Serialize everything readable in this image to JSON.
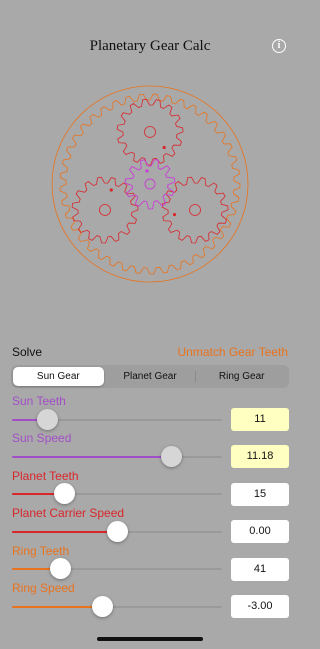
{
  "header": {
    "title": "Planetary Gear Calc",
    "info_icon": "info-icon",
    "info_glyph": "i"
  },
  "diagram": {
    "colors": {
      "ring": "#e8731f",
      "planet": "#d9262b",
      "sun": "#c93dd6"
    }
  },
  "solve": {
    "label": "Solve",
    "unmatch_label": "Unmatch Gear Teeth"
  },
  "segments": [
    {
      "label": "Sun Gear",
      "selected": true
    },
    {
      "label": "Planet Gear",
      "selected": false
    },
    {
      "label": "Ring Gear",
      "selected": false
    }
  ],
  "params": [
    {
      "label": "Sun Teeth",
      "value": "11",
      "slider_fraction": 0.17,
      "highlight": true,
      "color": "#a24fc7"
    },
    {
      "label": "Sun Speed",
      "value": "11.18",
      "slider_fraction": 0.76,
      "highlight": true,
      "color": "#a24fc7"
    },
    {
      "label": "Planet Teeth",
      "value": "15",
      "slider_fraction": 0.25,
      "highlight": false,
      "color": "#d9262b"
    },
    {
      "label": "Planet Carrier Speed",
      "value": "0.00",
      "slider_fraction": 0.5,
      "highlight": false,
      "color": "#d9262b"
    },
    {
      "label": "Ring Teeth",
      "value": "41",
      "slider_fraction": 0.23,
      "highlight": false,
      "color": "#e8731f"
    },
    {
      "label": "Ring Speed",
      "value": "-3.00",
      "slider_fraction": 0.43,
      "highlight": false,
      "color": "#e8731f"
    }
  ]
}
